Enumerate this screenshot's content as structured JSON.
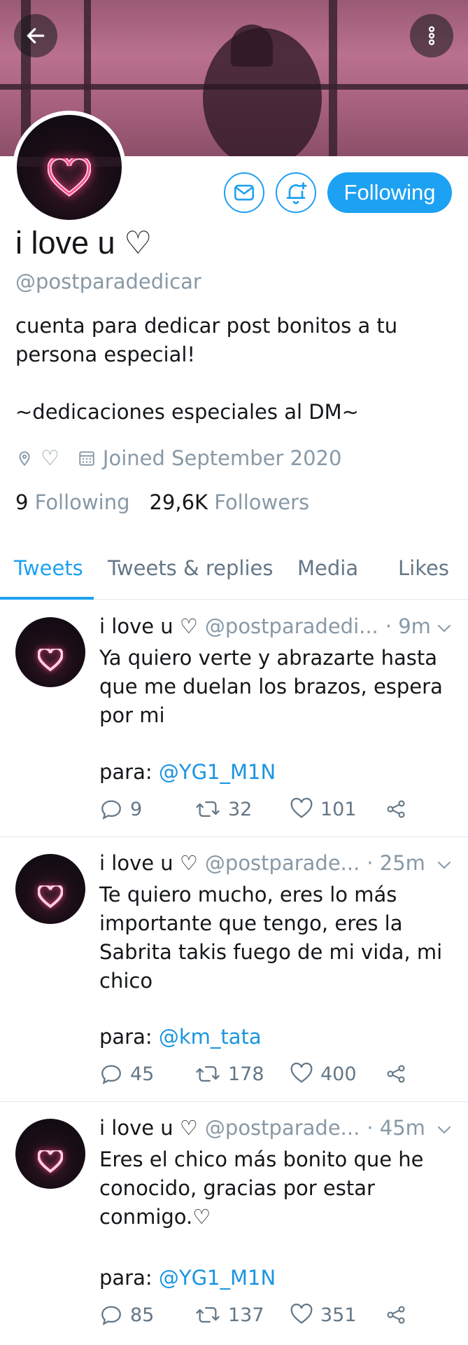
{
  "header": {
    "back_icon": "arrow-left-icon",
    "more_icon": "more-vertical-icon"
  },
  "profile": {
    "display_name": "i love u ♡",
    "handle": "@postparadedicar",
    "bio_line1": "cuenta para dedicar post bonitos a tu",
    "bio_line2": "persona especial!",
    "bio_line3": "~dedicaciones especiales al DM~",
    "location_icon": "location-pin-icon",
    "heart_outline_text": "♡",
    "joined": "Joined September 2020",
    "following_count": "9",
    "following_label": "Following",
    "followers_count": "29,6K",
    "followers_label": "Followers",
    "follow_button_label": "Following",
    "message_icon": "envelope-icon",
    "notify_icon": "bell-plus-icon"
  },
  "tabs": [
    {
      "label": "Tweets",
      "active": true
    },
    {
      "label": "Tweets & replies",
      "active": false
    },
    {
      "label": "Media",
      "active": false
    },
    {
      "label": "Likes",
      "active": false
    }
  ],
  "tweets": [
    {
      "name": "i love u ♡",
      "handle": "@postparadedi...",
      "time": "· 9m",
      "text": "Ya quiero verte y abrazarte hasta que me duelan los brazos, espera por mi",
      "para_label": "para: ",
      "mention": "@YG1_M1N",
      "replies": "9",
      "retweets": "32",
      "likes": "101"
    },
    {
      "name": "i love u ♡",
      "handle": "@postparade...",
      "time": "· 25m",
      "text": "Te quiero mucho, eres lo más importante que tengo, eres la Sabrita takis fuego de mi vida, mi chico",
      "para_label": "para: ",
      "mention": "@km_tata",
      "replies": "45",
      "retweets": "178",
      "likes": "400"
    },
    {
      "name": "i love u ♡",
      "handle": "@postparade...",
      "time": "· 45m",
      "text": "Eres el chico más bonito que he conocido, gracias por estar conmigo.♡",
      "para_label": "para: ",
      "mention": "@YG1_M1N",
      "replies": "85",
      "retweets": "137",
      "likes": "351"
    }
  ],
  "colors": {
    "accent": "#1da1f2",
    "muted": "#8899a6",
    "neon_heart": "#ff6b9a"
  }
}
